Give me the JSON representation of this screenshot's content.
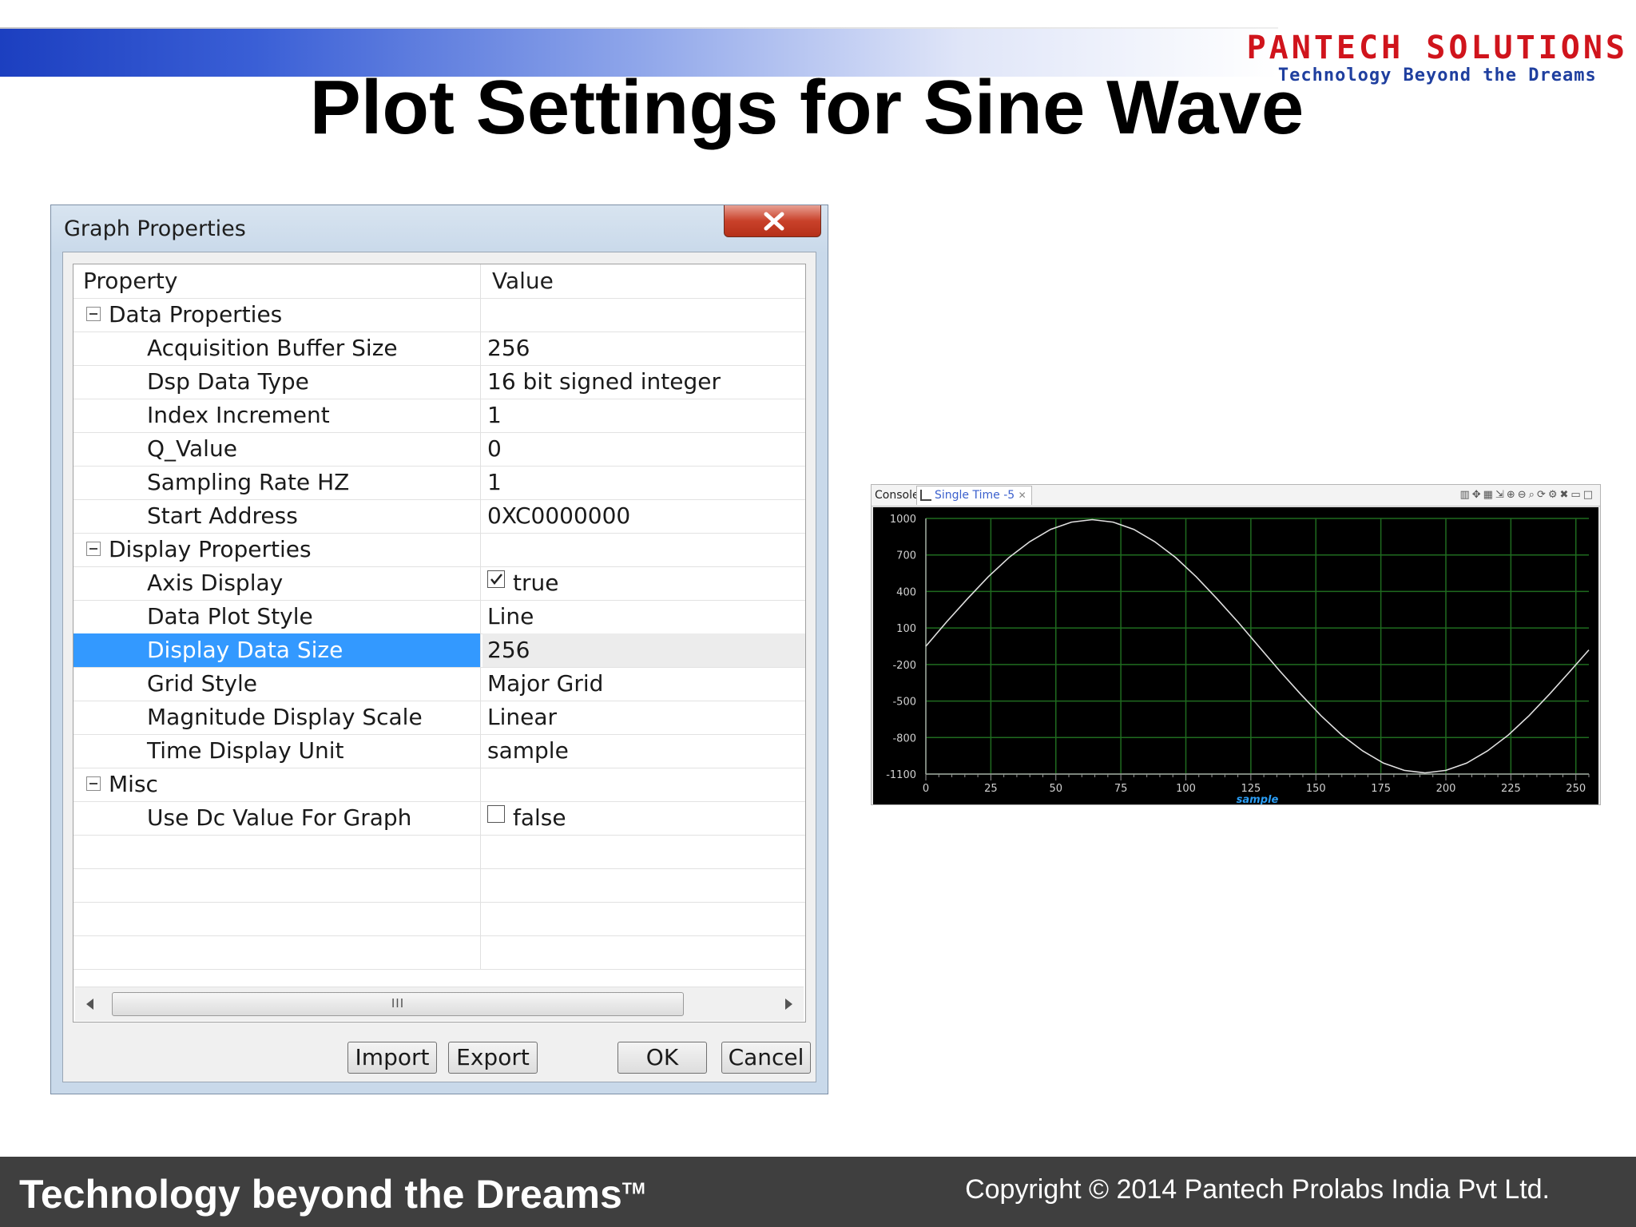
{
  "slide": {
    "title": "Plot Settings for Sine Wave",
    "logo_brand": "PANTECH SOLUTIONS",
    "logo_tagline": "Technology Beyond the Dreams",
    "footer_left": "Technology beyond the Dreams",
    "footer_tm": "TM",
    "footer_right": "Copyright © 2014 Pantech Prolabs India Pvt Ltd."
  },
  "dialog": {
    "title": "Graph Properties",
    "close_icon": "close-x-icon",
    "columns": {
      "property": "Property",
      "value": "Value"
    },
    "rows": [
      {
        "type": "group",
        "label": "Data Properties",
        "value": ""
      },
      {
        "type": "item",
        "label": "Acquisition Buffer Size",
        "value": "256"
      },
      {
        "type": "item",
        "label": "Dsp Data Type",
        "value": "16 bit signed integer"
      },
      {
        "type": "item",
        "label": "Index Increment",
        "value": "1"
      },
      {
        "type": "item",
        "label": "Q_Value",
        "value": "0"
      },
      {
        "type": "item",
        "label": "Sampling Rate HZ",
        "value": "1"
      },
      {
        "type": "item",
        "label": "Start Address",
        "value": "0XC0000000"
      },
      {
        "type": "group",
        "label": "Display Properties",
        "value": ""
      },
      {
        "type": "checkbox",
        "label": "Axis Display",
        "value": "true",
        "checked": true
      },
      {
        "type": "item",
        "label": "Data Plot Style",
        "value": "Line"
      },
      {
        "type": "item",
        "label": "Display Data Size",
        "value": "256",
        "selected": true
      },
      {
        "type": "item",
        "label": "Grid Style",
        "value": "Major Grid"
      },
      {
        "type": "item",
        "label": "Magnitude Display Scale",
        "value": "Linear"
      },
      {
        "type": "item",
        "label": "Time Display Unit",
        "value": "sample"
      },
      {
        "type": "group",
        "label": "Misc",
        "value": ""
      },
      {
        "type": "checkbox",
        "label": "Use Dc Value For Graph",
        "value": "false",
        "checked": false
      }
    ],
    "scroll_thumb_label": "III",
    "buttons": {
      "import": "Import",
      "export": "Export",
      "ok": "OK",
      "cancel": "Cancel"
    },
    "colors": {
      "selected_row": "#3399ff",
      "close_button": "#c9412a"
    }
  },
  "plot_panel": {
    "tab_console": "Console",
    "tab_active": "Single Time -5",
    "toolbar_icons": [
      "layout-icon",
      "move-icon",
      "grid-icon",
      "cursor-icon",
      "zoom-in-icon",
      "zoom-out-icon",
      "zoom-fit-icon",
      "refresh-icon",
      "settings-icon",
      "pin-icon",
      "minimize-icon",
      "maximize-icon"
    ]
  },
  "chart_data": {
    "type": "line",
    "title": "",
    "xlabel": "sample",
    "ylabel": "",
    "xlim": [
      0,
      255
    ],
    "ylim": [
      -1100,
      1000
    ],
    "xticks": [
      0,
      25,
      50,
      75,
      100,
      125,
      150,
      175,
      200,
      225,
      250
    ],
    "yticks": [
      1000,
      700,
      400,
      100,
      -200,
      -500,
      -800,
      -1100
    ],
    "grid": true,
    "colors": {
      "background": "#000000",
      "grid": "#1f6b1f",
      "line": "#e0e0e0",
      "axis_text": "#d0d0d0",
      "xlabel": "#2a9df4"
    },
    "series": [
      {
        "x": [
          0,
          8,
          16,
          24,
          32,
          40,
          48,
          56,
          64,
          72,
          80,
          88,
          96,
          104,
          112,
          120,
          128,
          136,
          144,
          152,
          160,
          168,
          176,
          184,
          192,
          200,
          208,
          216,
          224,
          232,
          240,
          248,
          255
        ],
        "values": [
          -50,
          150,
          340,
          520,
          680,
          810,
          910,
          970,
          990,
          970,
          910,
          810,
          680,
          520,
          340,
          150,
          -50,
          -250,
          -440,
          -620,
          -780,
          -910,
          -1010,
          -1070,
          -1090,
          -1070,
          -1010,
          -910,
          -780,
          -620,
          -440,
          -250,
          -80
        ]
      }
    ]
  }
}
